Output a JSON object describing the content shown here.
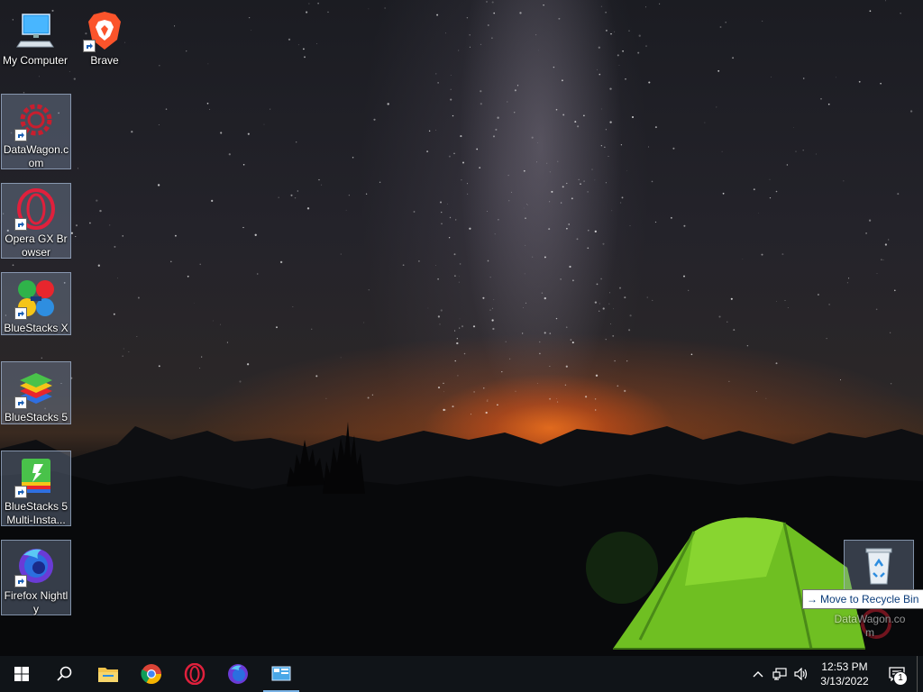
{
  "desktop": {
    "icons": [
      {
        "label": "My Computer"
      },
      {
        "label": "Brave"
      },
      {
        "label": "DataWagon.com"
      },
      {
        "label": "Opera GX Browser"
      },
      {
        "label": "BlueStacks X"
      },
      {
        "label": "BlueStacks 5"
      },
      {
        "label": "BlueStacks 5 Multi-Insta..."
      },
      {
        "label": "Firefox Nightly"
      },
      {
        "label": "DataWagon.com"
      }
    ],
    "recycle_bin": {
      "icon": "recycle-bin-icon"
    },
    "tooltip": {
      "arrow": "→",
      "text": "Move to Recycle Bin"
    }
  },
  "taskbar": {
    "start": "windows-logo-icon",
    "search": "search-icon",
    "pinned": [
      "file-explorer-icon",
      "chrome-icon",
      "opera-icon",
      "firefox-nightly-icon",
      "control-panel-icon"
    ],
    "tray": {
      "chevron": "^",
      "time": "12:53 PM",
      "date": "3/13/2022",
      "notification_count": "1"
    }
  },
  "colors": {
    "taskbar": "#101418",
    "tent_green": "#7fd02a",
    "accent": "#7ab3e6"
  }
}
